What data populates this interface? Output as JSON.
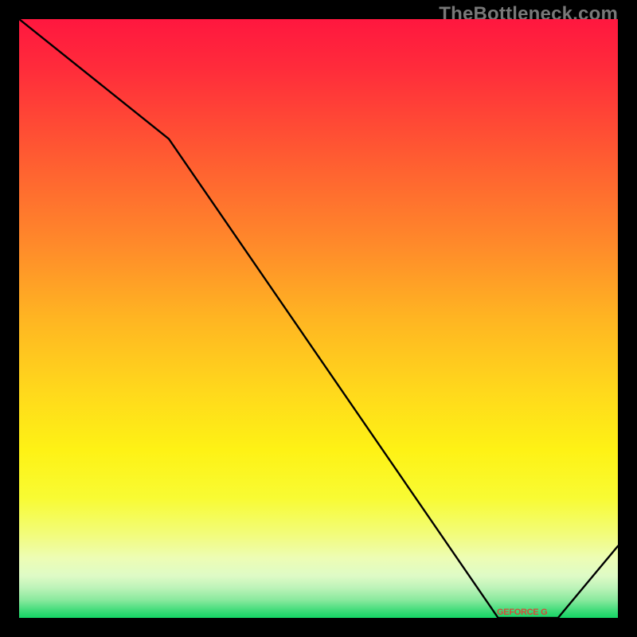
{
  "watermark": "TheBottleneck.com",
  "overlay_label": "GEFORCE G",
  "chart_data": {
    "type": "line",
    "title": "",
    "xlabel": "",
    "ylabel": "",
    "xlim": [
      0,
      100
    ],
    "ylim": [
      0,
      100
    ],
    "grid": false,
    "legend": false,
    "series": [
      {
        "name": "bottleneck-curve",
        "x": [
          0,
          25,
          80,
          90,
          100
        ],
        "y": [
          100,
          80,
          0,
          0,
          12
        ]
      }
    ],
    "markers": [
      {
        "name": "overlay-label",
        "x": 84,
        "y": 1
      }
    ],
    "gradient_stops": [
      {
        "pos": 0,
        "color": "#ff173f"
      },
      {
        "pos": 50,
        "color": "#ffd81c"
      },
      {
        "pos": 100,
        "color": "#14d564"
      }
    ]
  }
}
